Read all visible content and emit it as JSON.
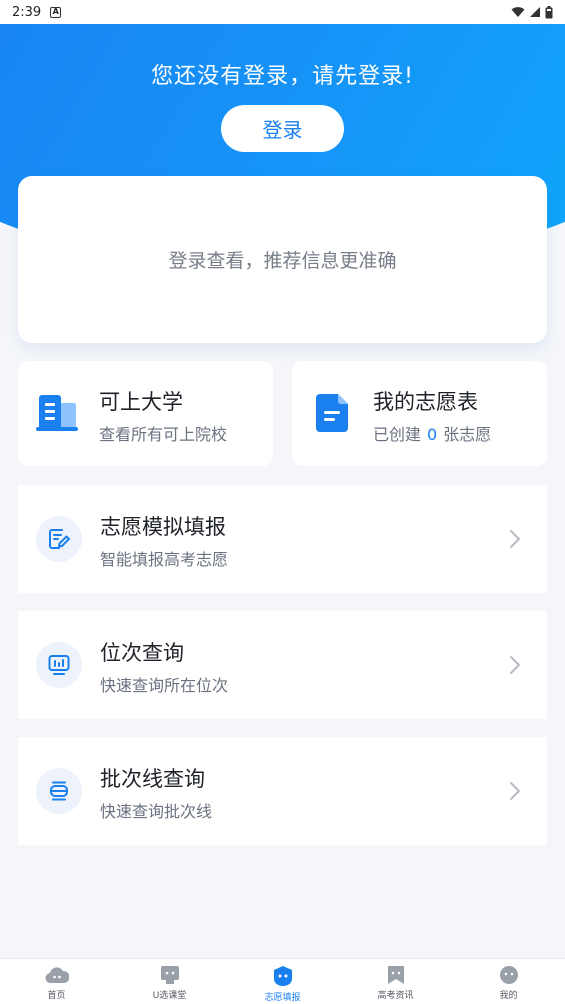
{
  "status_bar": {
    "time": "2:39",
    "notif_icon": "A"
  },
  "hero": {
    "title": "您还没有登录，请先登录!",
    "login_label": "登录"
  },
  "recommend": {
    "text": "登录查看，推荐信息更准确"
  },
  "features": [
    {
      "title": "可上大学",
      "subtitle": "查看所有可上院校",
      "icon": "building-icon"
    },
    {
      "title": "我的志愿表",
      "sub_prefix": "已创建",
      "count": "0",
      "sub_suffix": "张志愿",
      "icon": "document-icon"
    }
  ],
  "list": [
    {
      "title": "志愿模拟填报",
      "subtitle": "智能填报高考志愿",
      "icon": "edit-form-icon"
    },
    {
      "title": "位次查询",
      "subtitle": "快速查询所在位次",
      "icon": "chart-monitor-icon"
    },
    {
      "title": "批次线查询",
      "subtitle": "快速查询批次线",
      "icon": "layers-icon"
    }
  ],
  "nav": [
    {
      "label": "首页",
      "icon": "home-icon",
      "active": false
    },
    {
      "label": "U选课堂",
      "icon": "classroom-icon",
      "active": false
    },
    {
      "label": "志愿填报",
      "icon": "apply-icon",
      "active": true
    },
    {
      "label": "高考资讯",
      "icon": "news-icon",
      "active": false
    },
    {
      "label": "我的",
      "icon": "profile-icon",
      "active": false
    }
  ],
  "colors": {
    "accent": "#1a80f0",
    "background": "#f4f6f9"
  }
}
